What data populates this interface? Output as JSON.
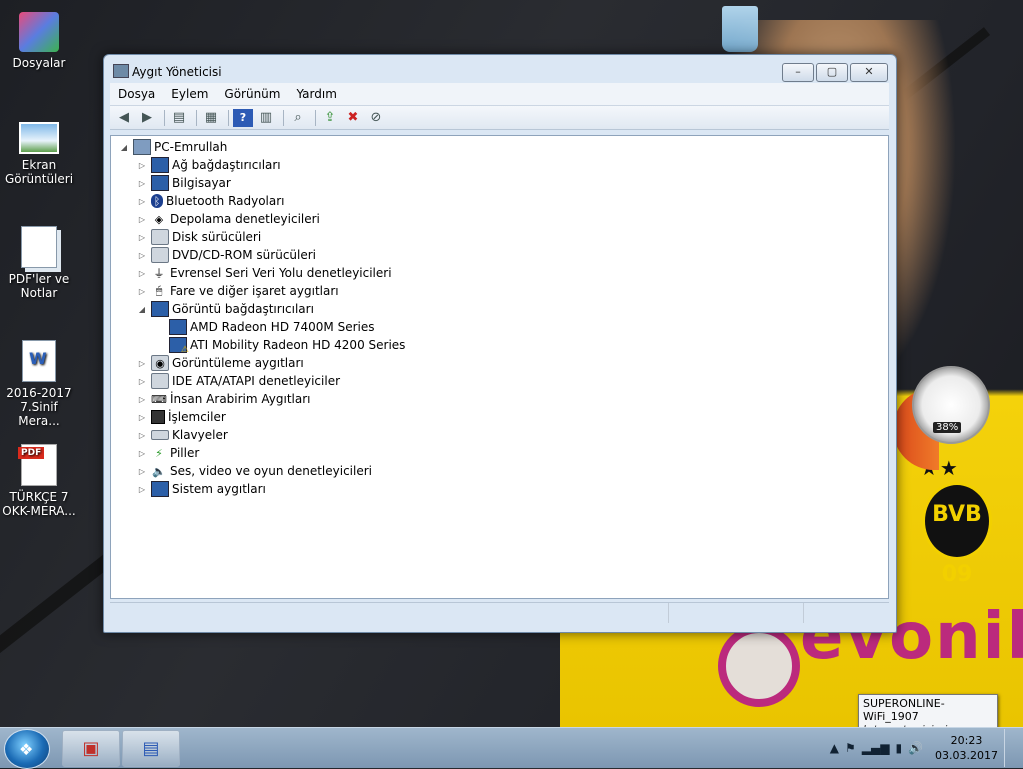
{
  "desktop": {
    "icons": [
      {
        "label": "Dosyalar"
      },
      {
        "label": "Ekran Görüntüleri"
      },
      {
        "label": "PDF'ler ve Notlar"
      },
      {
        "label": "2016-2017 7.Sinif Mera..."
      },
      {
        "label": "TÜRKÇE 7 OKK-MERA..."
      }
    ],
    "wallpaper_text": "evonik",
    "badge_text": "BVB 09",
    "gauge_percent": "38%"
  },
  "window": {
    "title": "Aygıt Yöneticisi",
    "controls": {
      "minimize": "–",
      "maximize": "▢",
      "close": "✕"
    },
    "menu": [
      "Dosya",
      "Eylem",
      "Görünüm",
      "Yardım"
    ],
    "tree": {
      "root": "PC-Emrullah",
      "items": [
        {
          "label": "Ağ bağdaştırıcıları",
          "icon": "network-icon"
        },
        {
          "label": "Bilgisayar",
          "icon": "computer-icon"
        },
        {
          "label": "Bluetooth Radyoları",
          "icon": "bluetooth-icon"
        },
        {
          "label": "Depolama denetleyicileri",
          "icon": "storage-icon"
        },
        {
          "label": "Disk sürücüleri",
          "icon": "disk-icon"
        },
        {
          "label": "DVD/CD-ROM sürücüleri",
          "icon": "dvd-icon"
        },
        {
          "label": "Evrensel Seri Veri Yolu denetleyicileri",
          "icon": "usb-icon"
        },
        {
          "label": "Fare ve diğer işaret aygıtları",
          "icon": "mouse-icon"
        },
        {
          "label": "Görüntü bağdaştırıcıları",
          "icon": "display-adapter-icon",
          "expanded": true,
          "children": [
            {
              "label": "AMD Radeon HD 7400M Series",
              "warning": false
            },
            {
              "label": "ATI Mobility Radeon HD 4200 Series",
              "warning": true
            }
          ]
        },
        {
          "label": "Görüntüleme aygıtları",
          "icon": "camera-icon"
        },
        {
          "label": "IDE ATA/ATAPI denetleyiciler",
          "icon": "ide-icon"
        },
        {
          "label": "İnsan Arabirim Aygıtları",
          "icon": "hid-icon"
        },
        {
          "label": "İşlemciler",
          "icon": "processor-icon"
        },
        {
          "label": "Klavyeler",
          "icon": "keyboard-icon"
        },
        {
          "label": "Piller",
          "icon": "battery-icon"
        },
        {
          "label": "Ses, video ve oyun denetleyicileri",
          "icon": "speaker-icon"
        },
        {
          "label": "Sistem aygıtları",
          "icon": "system-icon"
        }
      ]
    }
  },
  "taskbar": {
    "time": "20:23",
    "date": "03.03.2017"
  },
  "tooltip": {
    "title": "SUPERONLINE-WiFi_1907",
    "subtitle": "Internet erişimi"
  }
}
